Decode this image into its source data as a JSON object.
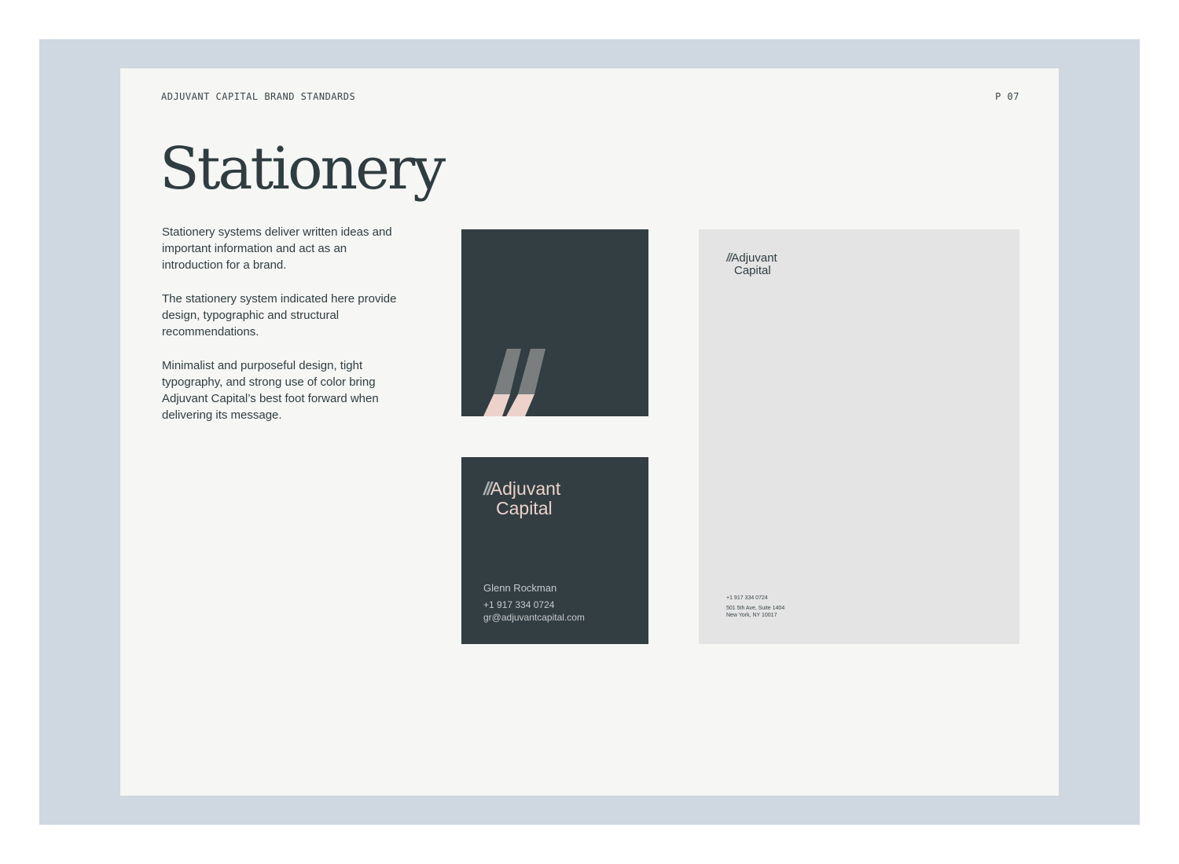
{
  "header": {
    "doc_title": "ADJUVANT CAPITAL BRAND STANDARDS",
    "page_number": "P 07"
  },
  "title": "Stationery",
  "body": {
    "paragraphs": [
      "Stationery systems deliver written ideas and important information and act as an introduction for a brand.",
      "The stationery system indicated here provide design, typographic and structural recommendations.",
      "Minimalist and purposeful design, tight typography, and strong use of color bring Adjuvant Capital’s best foot forward when delivering its message."
    ]
  },
  "business_card_back": {
    "icon": "double-slash-mark-icon"
  },
  "business_card_front": {
    "logo": {
      "slashes": "//",
      "line1": "Adjuvant",
      "line2": "Capital"
    },
    "name": "Glenn Rockman",
    "phone": "+1 917 334 0724",
    "email": "gr@adjuvantcapital.com"
  },
  "letterhead": {
    "logo": {
      "slashes": "//",
      "line1": "Adjuvant",
      "line2": "Capital"
    },
    "phone": "+1 917 334 0724",
    "address_line1": "501 5th Ave, Suite 1404",
    "address_line2": "New York, NY 10017"
  },
  "colors": {
    "backdrop": "#cfd7e0",
    "page": "#f6f6f4",
    "dark_slate": "#323e42",
    "blush": "#ecd2cb",
    "grey_stroke": "#7a7e7e",
    "letterhead": "#e4e4e4"
  }
}
